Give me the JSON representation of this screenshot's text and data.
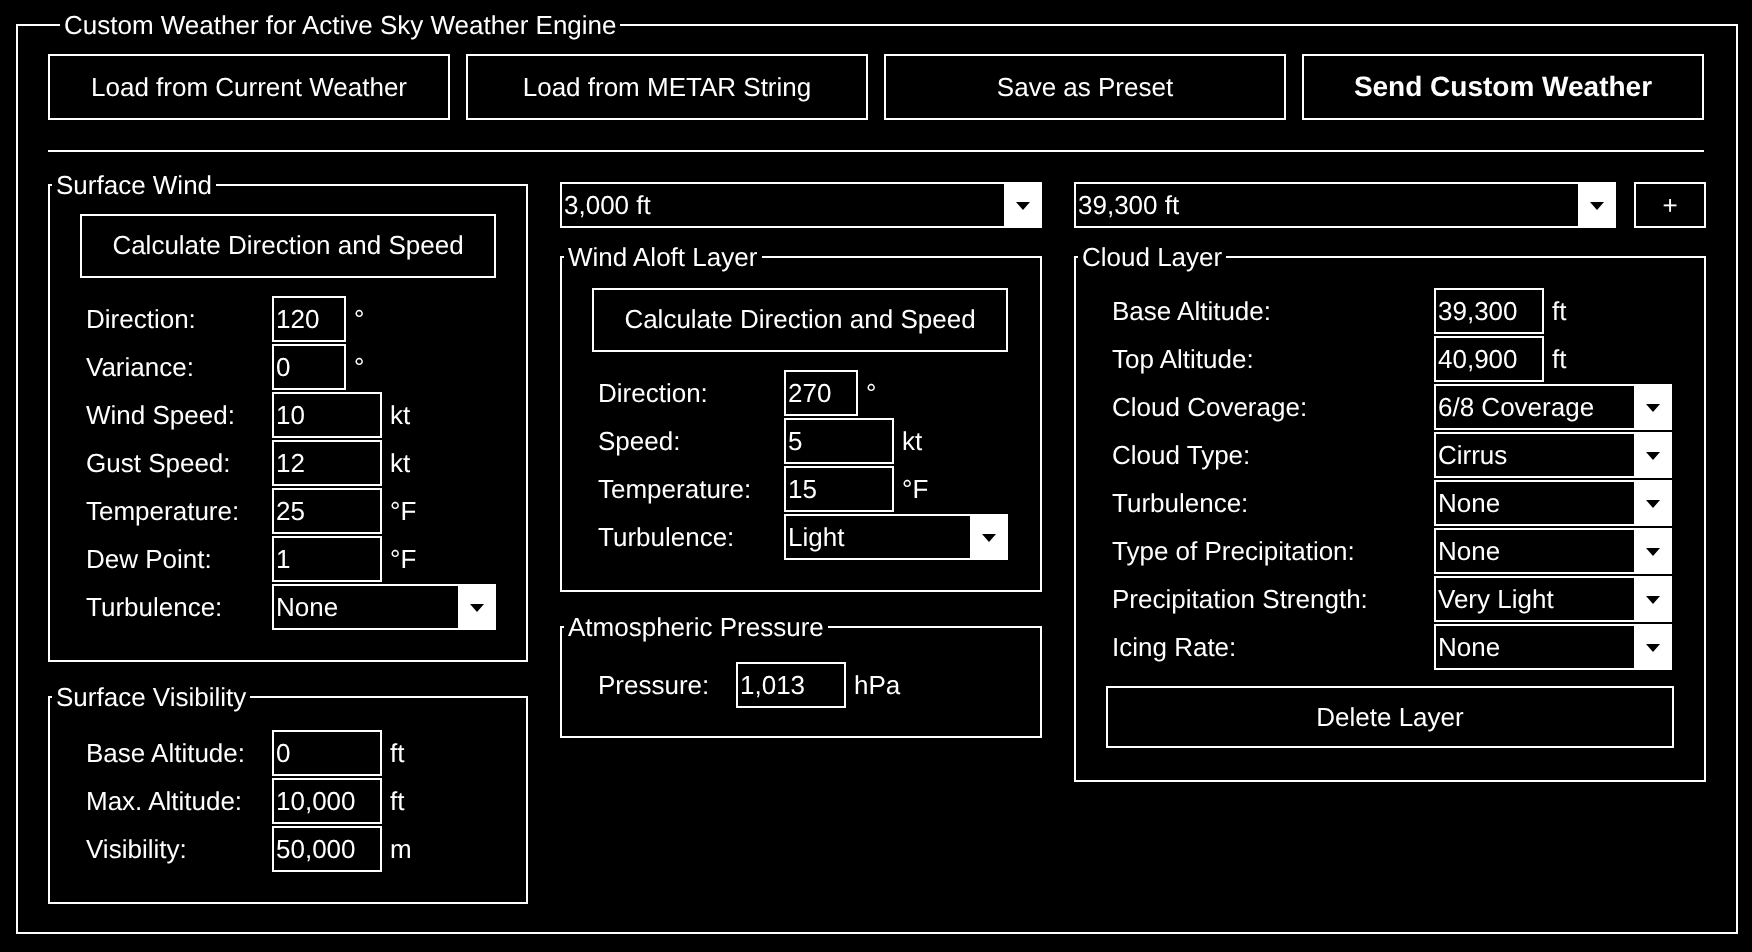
{
  "window": {
    "title": "Custom Weather for Active Sky Weather Engine"
  },
  "actions": [
    {
      "label": "Load from Current Weather",
      "emphasized": false
    },
    {
      "label": "Load from METAR String",
      "emphasized": false
    },
    {
      "label": "Save as Preset",
      "emphasized": false
    },
    {
      "label": "Send Custom Weather",
      "emphasized": true
    }
  ],
  "surface_wind": {
    "title": "Surface Wind",
    "calculate_button": "Calculate Direction and Speed",
    "fields": [
      {
        "label": "Direction:",
        "kind": "short",
        "value": "120",
        "unit": "°"
      },
      {
        "label": "Variance:",
        "kind": "short",
        "value": "0",
        "unit": "°"
      },
      {
        "label": "Wind Speed:",
        "kind": "number",
        "value": "10",
        "unit": "kt"
      },
      {
        "label": "Gust Speed:",
        "kind": "number",
        "value": "12",
        "unit": "kt"
      },
      {
        "label": "Temperature:",
        "kind": "number",
        "value": "25",
        "unit": "°F"
      },
      {
        "label": "Dew Point:",
        "kind": "number",
        "value": "1",
        "unit": "°F"
      },
      {
        "label": "Turbulence:",
        "kind": "dropdown",
        "value": "None"
      }
    ]
  },
  "surface_visibility": {
    "title": "Surface Visibility",
    "fields": [
      {
        "label": "Base Altitude:",
        "kind": "number",
        "value": "0",
        "unit": "ft"
      },
      {
        "label": "Max. Altitude:",
        "kind": "number",
        "value": "10,000",
        "unit": "ft"
      },
      {
        "label": "Visibility:",
        "kind": "number",
        "value": "50,000",
        "unit": "m"
      }
    ]
  },
  "wind_aloft_selector": {
    "value": "3,000 ft"
  },
  "wind_aloft_layer": {
    "title": "Wind Aloft Layer",
    "calculate_button": "Calculate Direction and Speed",
    "fields": [
      {
        "label": "Direction:",
        "kind": "short",
        "value": "270",
        "unit": "°"
      },
      {
        "label": "Speed:",
        "kind": "number",
        "value": "5",
        "unit": "kt"
      },
      {
        "label": "Temperature:",
        "kind": "number",
        "value": "15",
        "unit": "°F"
      },
      {
        "label": "Turbulence:",
        "kind": "dropdown",
        "value": "Light"
      }
    ]
  },
  "atmospheric_pressure": {
    "title": "Atmospheric Pressure",
    "fields": [
      {
        "label": "Pressure:",
        "kind": "number",
        "value": "1,013",
        "unit": "hPa"
      }
    ]
  },
  "cloud_layer_selector": {
    "value": "39,300 ft"
  },
  "add_layer_button": "+",
  "cloud_layer": {
    "title": "Cloud Layer",
    "fields": [
      {
        "label": "Base Altitude:",
        "kind": "number",
        "value": "39,300",
        "unit": "ft"
      },
      {
        "label": "Top Altitude:",
        "kind": "number",
        "value": "40,900",
        "unit": "ft"
      },
      {
        "label": "Cloud Coverage:",
        "kind": "dropdown",
        "value": "6/8 Coverage"
      },
      {
        "label": "Cloud Type:",
        "kind": "dropdown",
        "value": "Cirrus"
      },
      {
        "label": "Turbulence:",
        "kind": "dropdown",
        "value": "None"
      },
      {
        "label": "Type of Precipitation:",
        "kind": "dropdown",
        "value": "None"
      },
      {
        "label": "Precipitation Strength:",
        "kind": "dropdown",
        "value": "Very Light"
      },
      {
        "label": "Icing Rate:",
        "kind": "dropdown",
        "value": "None"
      }
    ],
    "delete_button": "Delete Layer"
  }
}
